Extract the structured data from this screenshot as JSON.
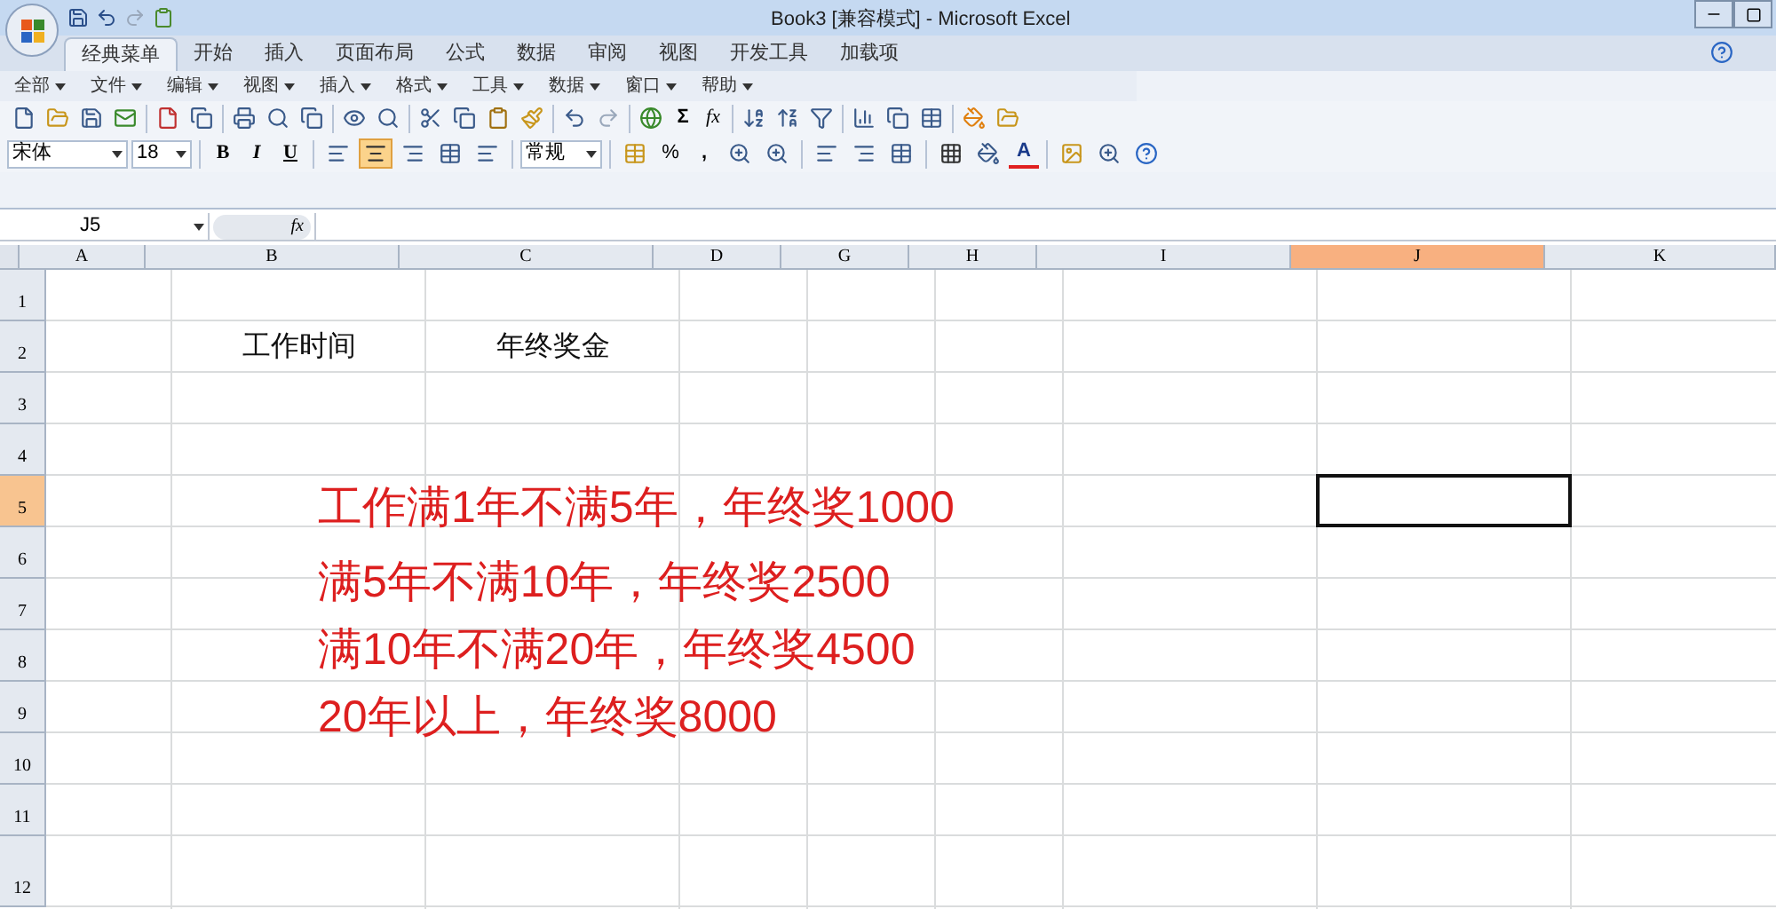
{
  "window": {
    "title": "Book3  [兼容模式] - Microsoft Excel"
  },
  "ribbon_tabs": [
    {
      "label": "经典菜单",
      "selected": true
    },
    {
      "label": "开始",
      "selected": false
    },
    {
      "label": "插入",
      "selected": false
    },
    {
      "label": "页面布局",
      "selected": false
    },
    {
      "label": "公式",
      "selected": false
    },
    {
      "label": "数据",
      "selected": false
    },
    {
      "label": "审阅",
      "selected": false
    },
    {
      "label": "视图",
      "selected": false
    },
    {
      "label": "开发工具",
      "selected": false
    },
    {
      "label": "加载项",
      "selected": false
    }
  ],
  "menus": [
    "全部",
    "文件",
    "编辑",
    "视图",
    "插入",
    "格式",
    "工具",
    "数据",
    "窗口",
    "帮助"
  ],
  "toolbar": {
    "font": "宋体",
    "size": "18",
    "bold": "B",
    "italic": "I",
    "underline": "U",
    "number_format": "常规",
    "percent": "%",
    "comma": ",",
    "sum": "Σ",
    "function": "fx",
    "font_color": "A"
  },
  "formula_bar": {
    "name_box": "J5",
    "fx": "fx"
  },
  "columns": [
    {
      "label": "A",
      "selected": false
    },
    {
      "label": "B",
      "selected": false
    },
    {
      "label": "C",
      "selected": false
    },
    {
      "label": "D",
      "selected": false
    },
    {
      "label": "G",
      "selected": false
    },
    {
      "label": "H",
      "selected": false
    },
    {
      "label": "I",
      "selected": false
    },
    {
      "label": "J",
      "selected": true
    },
    {
      "label": "K",
      "selected": false
    }
  ],
  "rows": [
    {
      "label": "1",
      "selected": false
    },
    {
      "label": "2",
      "selected": false,
      "cells": {
        "b": "工作时间",
        "c": "年终奖金"
      }
    },
    {
      "label": "3",
      "selected": false
    },
    {
      "label": "4",
      "selected": false
    },
    {
      "label": "5",
      "selected": true
    },
    {
      "label": "6",
      "selected": false
    },
    {
      "label": "7",
      "selected": false
    },
    {
      "label": "8",
      "selected": false
    },
    {
      "label": "9",
      "selected": false
    },
    {
      "label": "10",
      "selected": false
    },
    {
      "label": "11",
      "selected": false
    },
    {
      "label": "12",
      "selected": false
    }
  ],
  "red_text": [
    "工作满1年不满5年，年终奖1000",
    "满5年不满10年，年终奖2500",
    "满10年不满20年，年终奖4500",
    "20年以上，年终奖8000"
  ]
}
